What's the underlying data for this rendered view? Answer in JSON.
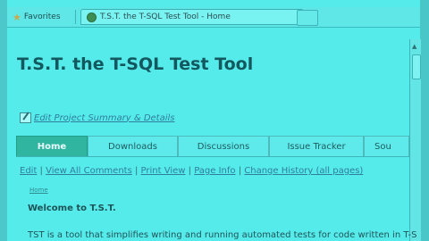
{
  "favorites_bar": {
    "favorites_label": "Favorites",
    "tab_title": "T.S.T. the T-SQL Test Tool - Home"
  },
  "page": {
    "title": "T.S.T. the T-SQL Test Tool",
    "edit_link": "Edit Project Summary & Details",
    "tabs": [
      {
        "label": "Home",
        "active": true
      },
      {
        "label": "Downloads",
        "active": false
      },
      {
        "label": "Discussions",
        "active": false
      },
      {
        "label": "Issue Tracker",
        "active": false
      },
      {
        "label": "Sou",
        "active": false
      }
    ],
    "actions": [
      "Edit",
      "View All Comments",
      "Print View",
      "Page Info",
      "Change History (all pages)"
    ],
    "breadcrumb": "Home",
    "heading": "Welcome to T.S.T.",
    "body_text": "TST is a tool that simplifies writing and running automated tests for code written in T-S"
  },
  "colors": {
    "tint": "#56ebeb",
    "active_tab": "#2fb5a0",
    "title": "#13585e",
    "link": "#2f7f9c"
  },
  "icons": [
    "star-icon",
    "tab-favicon-icon",
    "edit-icon",
    "scroll-up-arrow-icon"
  ]
}
